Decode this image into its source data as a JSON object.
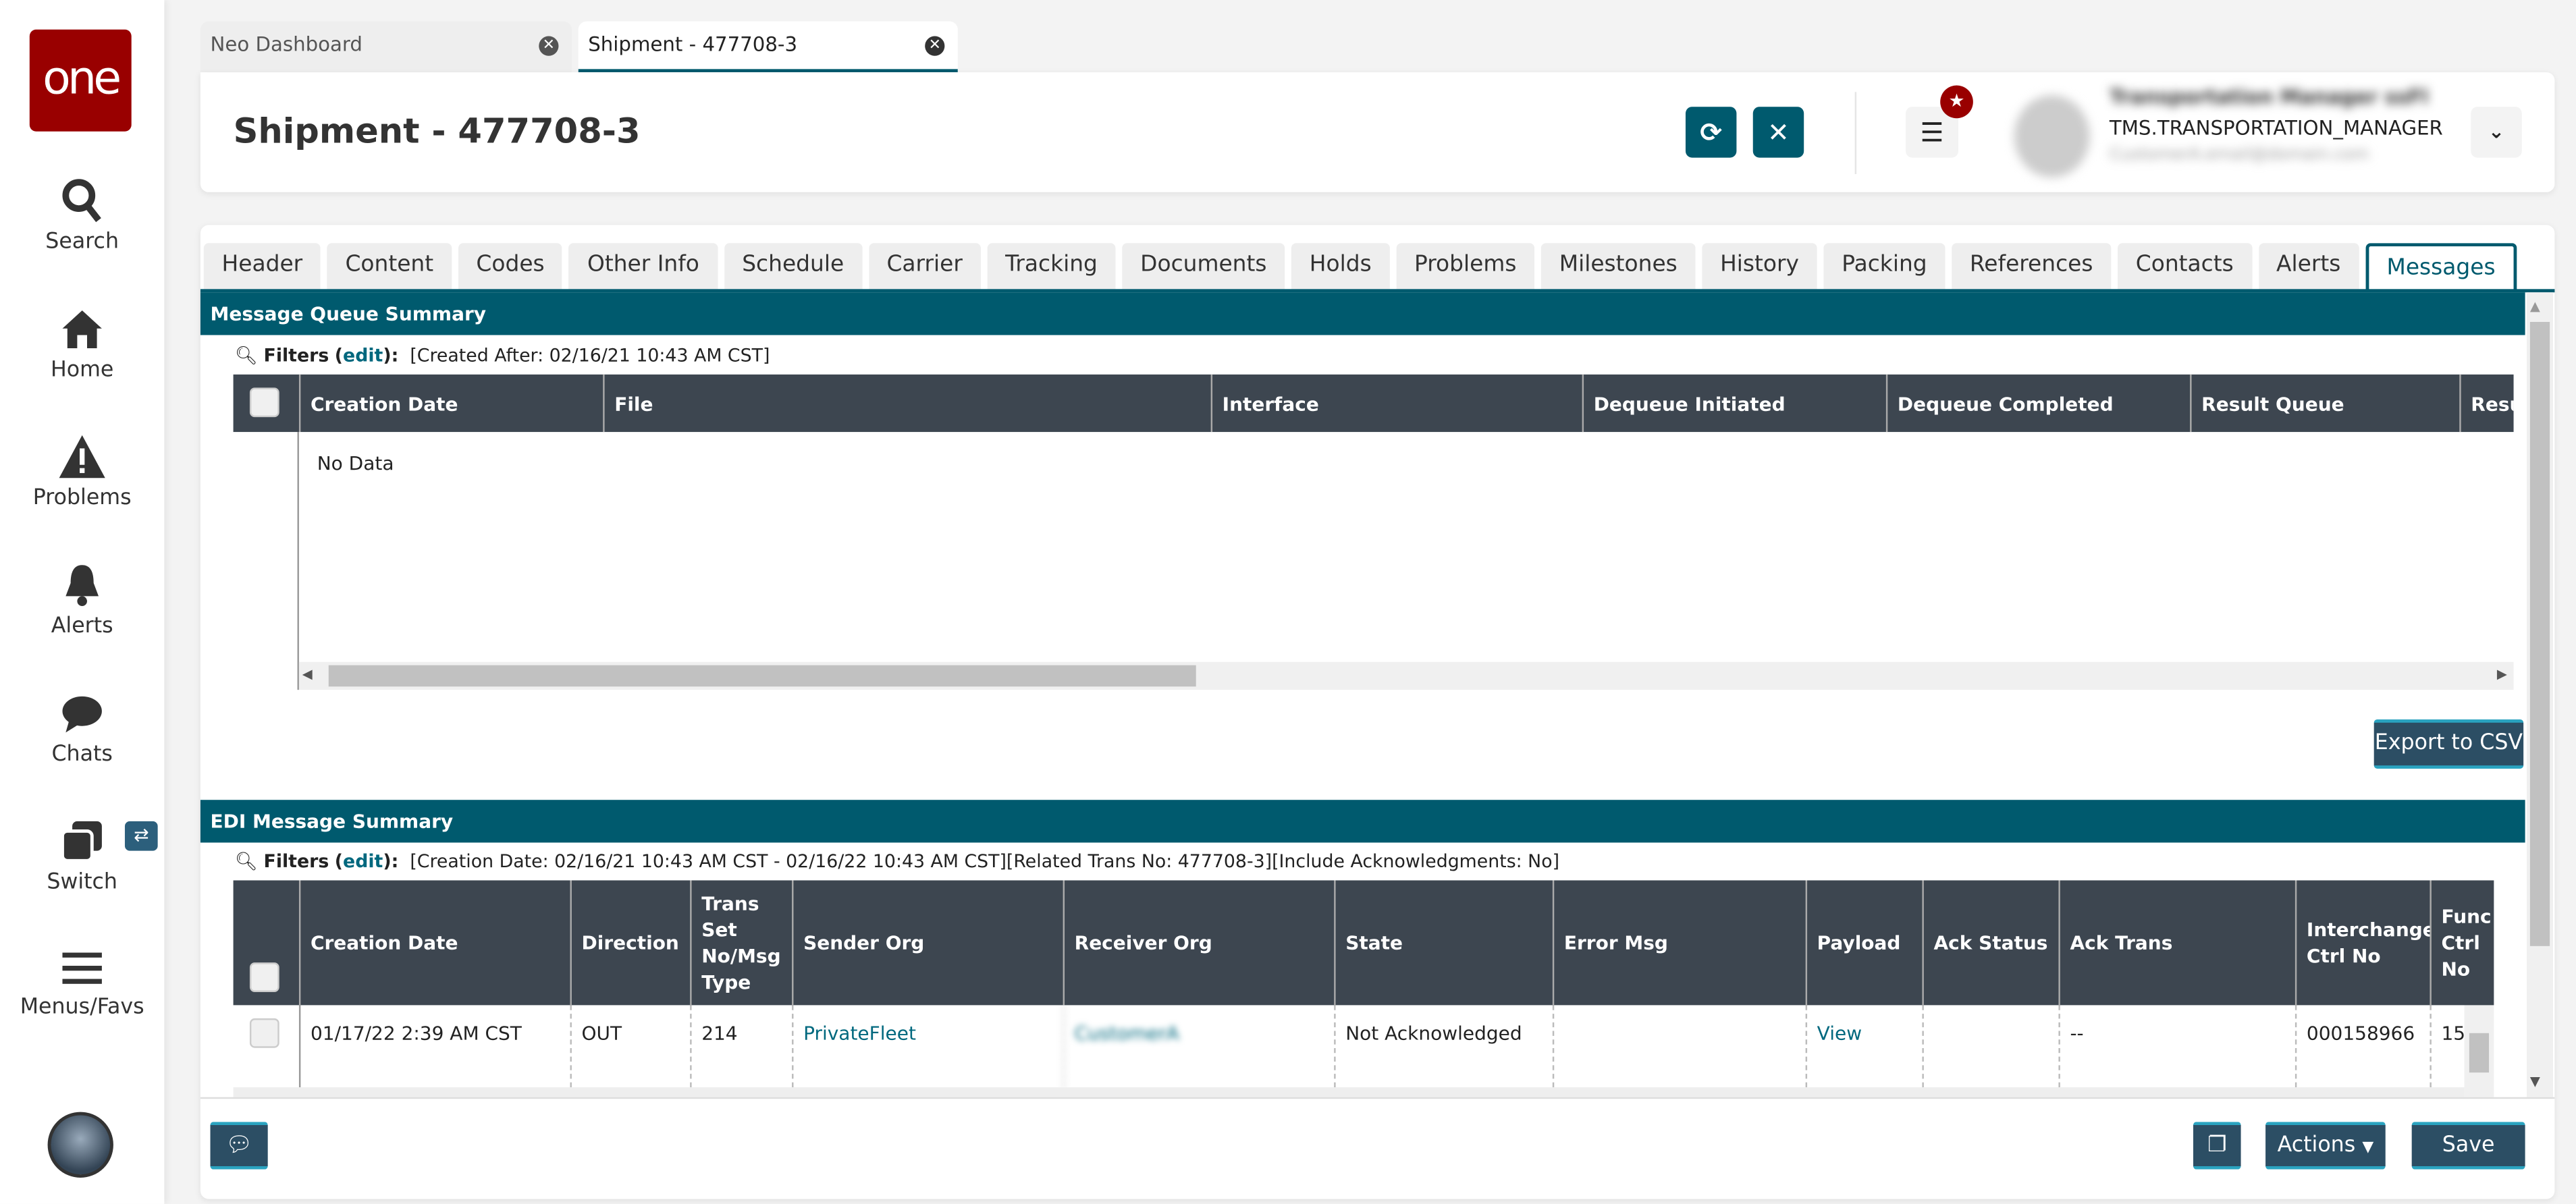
{
  "app": {
    "logo_text": "one",
    "brand_color": "#990000",
    "accent_color": "#005a6e"
  },
  "sidebar": {
    "items": [
      {
        "label": "Search",
        "icon": "search-icon"
      },
      {
        "label": "Home",
        "icon": "home-icon"
      },
      {
        "label": "Problems",
        "icon": "warning-icon"
      },
      {
        "label": "Alerts",
        "icon": "bell-icon"
      },
      {
        "label": "Chats",
        "icon": "chat-icon"
      },
      {
        "label": "Switch",
        "icon": "switch-icon"
      },
      {
        "label": "Menus/Favs",
        "icon": "menu-icon"
      }
    ]
  },
  "window_tabs": [
    {
      "label": "Neo Dashboard",
      "active": false
    },
    {
      "label": "Shipment - 477708-3",
      "active": true
    }
  ],
  "header": {
    "title": "Shipment - 477708-3",
    "user_name": "Transportation Manager ssFl",
    "user_role": "TMS.TRANSPORTATION_MANAGER",
    "user_email": "CustomerA.email@domain.com"
  },
  "detail_tabs": [
    "Header",
    "Content",
    "Codes",
    "Other Info",
    "Schedule",
    "Carrier",
    "Tracking",
    "Documents",
    "Holds",
    "Problems",
    "Milestones",
    "History",
    "Packing",
    "References",
    "Contacts",
    "Alerts",
    "Messages"
  ],
  "active_tab": "Messages",
  "mq": {
    "title": "Message Queue Summary",
    "filters_label": "Filters",
    "edit_label": "edit",
    "filter_text": "[Created After: 02/16/21 10:43 AM CST]",
    "columns": [
      "Creation Date",
      "File",
      "Interface",
      "Dequeue Initiated",
      "Dequeue Completed",
      "Result Queue",
      "Resu"
    ],
    "empty_text": "No Data",
    "export_label": "Export to CSV"
  },
  "edi": {
    "title": "EDI Message Summary",
    "filters_label": "Filters",
    "edit_label": "edit",
    "filter_text": "[Creation Date: 02/16/21 10:43 AM CST - 02/16/22 10:43 AM CST][Related Trans No: 477708-3][Include Acknowledgments: No]",
    "columns": [
      "Creation Date",
      "Direction",
      "Trans Set No/Msg Type",
      "Sender Org",
      "Receiver Org",
      "State",
      "Error Msg",
      "Payload",
      "Ack Status",
      "Ack Trans",
      "Interchange Ctrl No",
      "Func Ctrl No"
    ],
    "rows": [
      [
        "01/17/22 2:39 AM CST",
        "OUT",
        "214",
        "PrivateFleet",
        "CustomerA",
        "Not Acknowledged",
        "",
        "View",
        "",
        "--",
        "000158966",
        "15"
      ]
    ]
  },
  "footer": {
    "actions_label": "Actions",
    "save_label": "Save"
  }
}
